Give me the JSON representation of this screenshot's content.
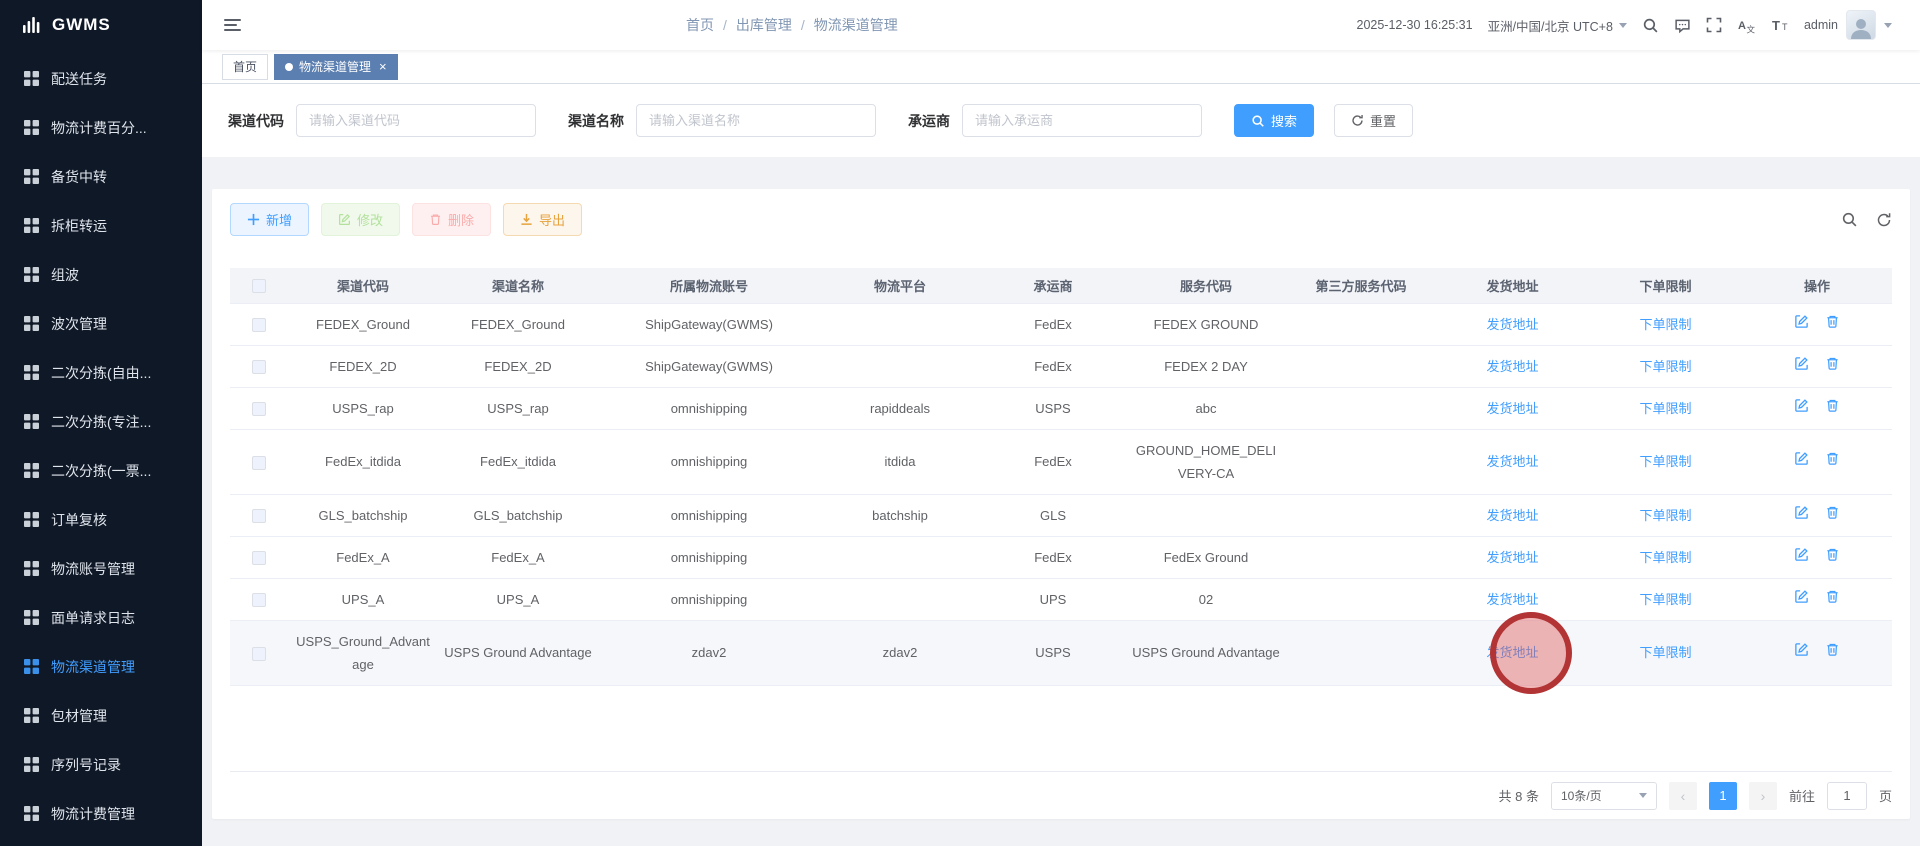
{
  "app": {
    "logo_text": "GWMS"
  },
  "header": {
    "breadcrumb": [
      "首页",
      "出库管理",
      "物流渠道管理"
    ],
    "datetime": "2025-12-30 16:25:31",
    "timezone": "亚洲/中国/北京 UTC+8",
    "username": "admin"
  },
  "sidebar": {
    "items": [
      {
        "label": "配送任务"
      },
      {
        "label": "物流计费百分..."
      },
      {
        "label": "备货中转"
      },
      {
        "label": "拆柜转运"
      },
      {
        "label": "组波"
      },
      {
        "label": "波次管理"
      },
      {
        "label": "二次分拣(自由..."
      },
      {
        "label": "二次分拣(专注..."
      },
      {
        "label": "二次分拣(一票..."
      },
      {
        "label": "订单复核"
      },
      {
        "label": "物流账号管理"
      },
      {
        "label": "面单请求日志"
      },
      {
        "label": "物流渠道管理",
        "active": true
      },
      {
        "label": "包材管理"
      },
      {
        "label": "序列号记录"
      },
      {
        "label": "物流计费管理"
      }
    ]
  },
  "tabs": [
    {
      "label": "首页"
    },
    {
      "label": "物流渠道管理",
      "active": true,
      "closable": true
    }
  ],
  "search": {
    "fields": [
      {
        "label": "渠道代码",
        "placeholder": "请输入渠道代码"
      },
      {
        "label": "渠道名称",
        "placeholder": "请输入渠道名称"
      },
      {
        "label": "承运商",
        "placeholder": "请输入承运商"
      }
    ],
    "search_label": "搜索",
    "reset_label": "重置"
  },
  "toolbar": {
    "add_label": "新增",
    "edit_label": "修改",
    "delete_label": "删除",
    "export_label": "导出"
  },
  "table": {
    "columns": [
      "渠道代码",
      "渠道名称",
      "所属物流账号",
      "物流平台",
      "承运商",
      "服务代码",
      "第三方服务代码",
      "发货地址",
      "下单限制",
      "操作"
    ],
    "address_link": "发货地址",
    "limit_link": "下单限制",
    "rows": [
      {
        "code": "FEDEX_Ground",
        "name": "FEDEX_Ground",
        "account": "ShipGateway(GWMS)",
        "platform": "",
        "carrier": "FedEx",
        "service": "FEDEX GROUND",
        "third_party": ""
      },
      {
        "code": "FEDEX_2D",
        "name": "FEDEX_2D",
        "account": "ShipGateway(GWMS)",
        "platform": "",
        "carrier": "FedEx",
        "service": "FEDEX 2 DAY",
        "third_party": ""
      },
      {
        "code": "USPS_rap",
        "name": "USPS_rap",
        "account": "omnishipping",
        "platform": "rapiddeals",
        "carrier": "USPS",
        "service": "abc",
        "third_party": ""
      },
      {
        "code": "FedEx_itdida",
        "name": "FedEx_itdida",
        "account": "omnishipping",
        "platform": "itdida",
        "carrier": "FedEx",
        "service": "GROUND_HOME_DELIVERY-CA",
        "third_party": ""
      },
      {
        "code": "GLS_batchship",
        "name": "GLS_batchship",
        "account": "omnishipping",
        "platform": "batchship",
        "carrier": "GLS",
        "service": "",
        "third_party": ""
      },
      {
        "code": "FedEx_A",
        "name": "FedEx_A",
        "account": "omnishipping",
        "platform": "",
        "carrier": "FedEx",
        "service": "FedEx Ground",
        "third_party": ""
      },
      {
        "code": "UPS_A",
        "name": "UPS_A",
        "account": "omnishipping",
        "platform": "",
        "carrier": "UPS",
        "service": "02",
        "third_party": ""
      },
      {
        "code": "USPS_Ground_Advantage",
        "name": "USPS Ground Advantage",
        "account": "zdav2",
        "platform": "zdav2",
        "carrier": "USPS",
        "service": "USPS Ground Advantage",
        "third_party": "",
        "highlighted": true,
        "annotated": true
      }
    ]
  },
  "pagination": {
    "total_text": "共 8 条",
    "page_size": "10条/页",
    "current_page": "1",
    "goto_label": "前往",
    "goto_value": "1",
    "page_label": "页"
  },
  "icons": {
    "close_glyph": "×",
    "prev_glyph": "‹",
    "next_glyph": "›"
  },
  "colors": {
    "accent": "#409eff",
    "sidebar_bg": "#0f1826",
    "active_tab_bg": "#5b7fb0",
    "annotation_ring": "#b23434"
  }
}
